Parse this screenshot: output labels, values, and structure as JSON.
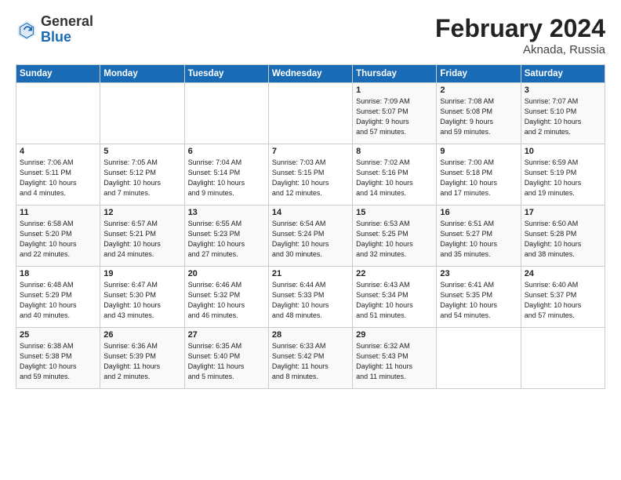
{
  "logo": {
    "general": "General",
    "blue": "Blue"
  },
  "title": "February 2024",
  "subtitle": "Aknada, Russia",
  "days": [
    "Sunday",
    "Monday",
    "Tuesday",
    "Wednesday",
    "Thursday",
    "Friday",
    "Saturday"
  ],
  "weeks": [
    [
      {
        "day": "",
        "info": ""
      },
      {
        "day": "",
        "info": ""
      },
      {
        "day": "",
        "info": ""
      },
      {
        "day": "",
        "info": ""
      },
      {
        "day": "1",
        "info": "Sunrise: 7:09 AM\nSunset: 5:07 PM\nDaylight: 9 hours\nand 57 minutes."
      },
      {
        "day": "2",
        "info": "Sunrise: 7:08 AM\nSunset: 5:08 PM\nDaylight: 9 hours\nand 59 minutes."
      },
      {
        "day": "3",
        "info": "Sunrise: 7:07 AM\nSunset: 5:10 PM\nDaylight: 10 hours\nand 2 minutes."
      }
    ],
    [
      {
        "day": "4",
        "info": "Sunrise: 7:06 AM\nSunset: 5:11 PM\nDaylight: 10 hours\nand 4 minutes."
      },
      {
        "day": "5",
        "info": "Sunrise: 7:05 AM\nSunset: 5:12 PM\nDaylight: 10 hours\nand 7 minutes."
      },
      {
        "day": "6",
        "info": "Sunrise: 7:04 AM\nSunset: 5:14 PM\nDaylight: 10 hours\nand 9 minutes."
      },
      {
        "day": "7",
        "info": "Sunrise: 7:03 AM\nSunset: 5:15 PM\nDaylight: 10 hours\nand 12 minutes."
      },
      {
        "day": "8",
        "info": "Sunrise: 7:02 AM\nSunset: 5:16 PM\nDaylight: 10 hours\nand 14 minutes."
      },
      {
        "day": "9",
        "info": "Sunrise: 7:00 AM\nSunset: 5:18 PM\nDaylight: 10 hours\nand 17 minutes."
      },
      {
        "day": "10",
        "info": "Sunrise: 6:59 AM\nSunset: 5:19 PM\nDaylight: 10 hours\nand 19 minutes."
      }
    ],
    [
      {
        "day": "11",
        "info": "Sunrise: 6:58 AM\nSunset: 5:20 PM\nDaylight: 10 hours\nand 22 minutes."
      },
      {
        "day": "12",
        "info": "Sunrise: 6:57 AM\nSunset: 5:21 PM\nDaylight: 10 hours\nand 24 minutes."
      },
      {
        "day": "13",
        "info": "Sunrise: 6:55 AM\nSunset: 5:23 PM\nDaylight: 10 hours\nand 27 minutes."
      },
      {
        "day": "14",
        "info": "Sunrise: 6:54 AM\nSunset: 5:24 PM\nDaylight: 10 hours\nand 30 minutes."
      },
      {
        "day": "15",
        "info": "Sunrise: 6:53 AM\nSunset: 5:25 PM\nDaylight: 10 hours\nand 32 minutes."
      },
      {
        "day": "16",
        "info": "Sunrise: 6:51 AM\nSunset: 5:27 PM\nDaylight: 10 hours\nand 35 minutes."
      },
      {
        "day": "17",
        "info": "Sunrise: 6:50 AM\nSunset: 5:28 PM\nDaylight: 10 hours\nand 38 minutes."
      }
    ],
    [
      {
        "day": "18",
        "info": "Sunrise: 6:48 AM\nSunset: 5:29 PM\nDaylight: 10 hours\nand 40 minutes."
      },
      {
        "day": "19",
        "info": "Sunrise: 6:47 AM\nSunset: 5:30 PM\nDaylight: 10 hours\nand 43 minutes."
      },
      {
        "day": "20",
        "info": "Sunrise: 6:46 AM\nSunset: 5:32 PM\nDaylight: 10 hours\nand 46 minutes."
      },
      {
        "day": "21",
        "info": "Sunrise: 6:44 AM\nSunset: 5:33 PM\nDaylight: 10 hours\nand 48 minutes."
      },
      {
        "day": "22",
        "info": "Sunrise: 6:43 AM\nSunset: 5:34 PM\nDaylight: 10 hours\nand 51 minutes."
      },
      {
        "day": "23",
        "info": "Sunrise: 6:41 AM\nSunset: 5:35 PM\nDaylight: 10 hours\nand 54 minutes."
      },
      {
        "day": "24",
        "info": "Sunrise: 6:40 AM\nSunset: 5:37 PM\nDaylight: 10 hours\nand 57 minutes."
      }
    ],
    [
      {
        "day": "25",
        "info": "Sunrise: 6:38 AM\nSunset: 5:38 PM\nDaylight: 10 hours\nand 59 minutes."
      },
      {
        "day": "26",
        "info": "Sunrise: 6:36 AM\nSunset: 5:39 PM\nDaylight: 11 hours\nand 2 minutes."
      },
      {
        "day": "27",
        "info": "Sunrise: 6:35 AM\nSunset: 5:40 PM\nDaylight: 11 hours\nand 5 minutes."
      },
      {
        "day": "28",
        "info": "Sunrise: 6:33 AM\nSunset: 5:42 PM\nDaylight: 11 hours\nand 8 minutes."
      },
      {
        "day": "29",
        "info": "Sunrise: 6:32 AM\nSunset: 5:43 PM\nDaylight: 11 hours\nand 11 minutes."
      },
      {
        "day": "",
        "info": ""
      },
      {
        "day": "",
        "info": ""
      }
    ]
  ]
}
